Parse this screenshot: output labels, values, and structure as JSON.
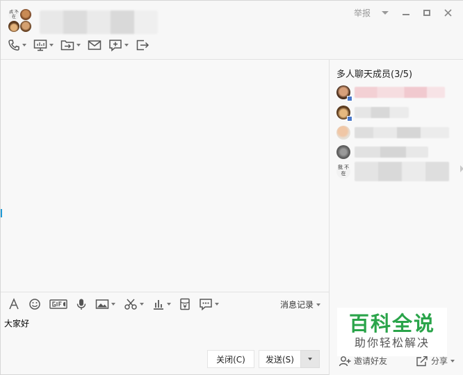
{
  "header": {
    "group_avatar_top_left": "我 不在",
    "report_label": "举报"
  },
  "icons": {
    "phone": "phone-icon",
    "screen_share": "screen-share-icon",
    "file_transfer": "file-transfer-icon",
    "mail": "mail-icon",
    "app_add": "app-add-icon",
    "exit": "exit-icon"
  },
  "members": {
    "title": "多人聊天成员(3/5)",
    "offline_avatar_text": "我 不在"
  },
  "input_toolbar": {
    "history_label": "消息记录"
  },
  "input": {
    "text": "大家好"
  },
  "buttons": {
    "close_label": "关闭(C)",
    "send_label": "发送(S)",
    "invite_label": "邀请好友",
    "share_label": "分享"
  },
  "watermark": {
    "main": "百科全说",
    "sub": "助你轻松解决"
  },
  "colors": {
    "badge": "#4a78c9",
    "watermark_green": "#2aa44a"
  }
}
